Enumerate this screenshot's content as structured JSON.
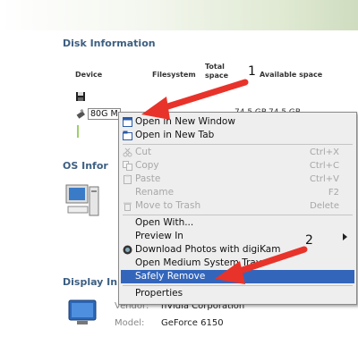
{
  "disk_section": {
    "title": "Disk Information",
    "columns": {
      "device": "Device",
      "filesystem": "Filesystem",
      "total_space": "Total space",
      "available_space": "Available space"
    },
    "device_label": "80G M",
    "total_value": "74.5 GB",
    "available_value": "74.5 GB"
  },
  "os_section": {
    "title": "OS Infor"
  },
  "display_section": {
    "title": "Display In",
    "vendor_label": "Vendor:",
    "vendor_value": "nVidia Corporation",
    "model_label": "Model:",
    "model_value": "GeForce 6150"
  },
  "context_menu": {
    "items": [
      {
        "label": "Open in New Window",
        "enabled": true,
        "icon": "window-icon"
      },
      {
        "label": "Open in New Tab",
        "enabled": true,
        "icon": "tab-icon"
      },
      {
        "label": "Cut",
        "shortcut": "Ctrl+X",
        "enabled": false,
        "icon": "scissors-icon"
      },
      {
        "label": "Copy",
        "shortcut": "Ctrl+C",
        "enabled": false,
        "icon": "copy-icon"
      },
      {
        "label": "Paste",
        "shortcut": "Ctrl+V",
        "enabled": false,
        "icon": "paste-icon"
      },
      {
        "label": "Rename",
        "shortcut": "F2",
        "enabled": false
      },
      {
        "label": "Move to Trash",
        "shortcut": "Delete",
        "enabled": false,
        "icon": "trash-icon"
      },
      {
        "label": "Open With...",
        "enabled": true
      },
      {
        "label": "Preview In",
        "enabled": true,
        "submenu": true
      },
      {
        "label": "Download Photos with digiKam",
        "enabled": true,
        "icon": "digikam-icon"
      },
      {
        "label": "Open Medium System Tray",
        "enabled": true
      },
      {
        "label": "Safely Remove",
        "enabled": true,
        "highlighted": true
      },
      {
        "label": "Properties",
        "enabled": true
      }
    ]
  },
  "annotations": {
    "callout_1": "1",
    "callout_2": "2"
  },
  "colors": {
    "accent_title": "#3d5f82",
    "menu_highlight": "#3366bb",
    "arrow_red": "#e8332a"
  }
}
